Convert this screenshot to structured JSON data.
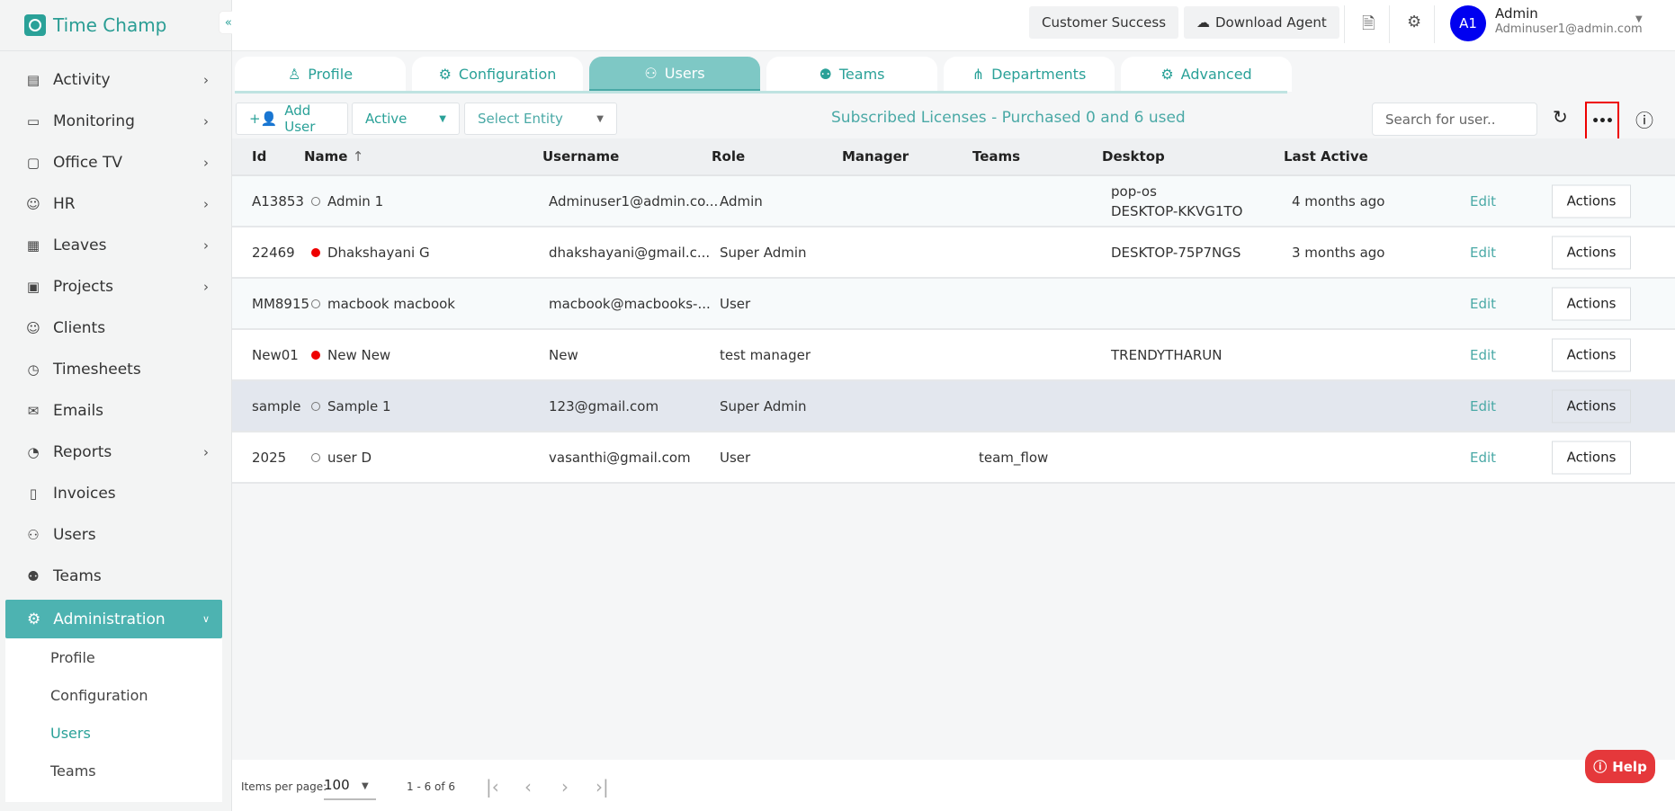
{
  "app": {
    "name": "Time Champ"
  },
  "sidebar": {
    "items": [
      {
        "label": "Activity",
        "icon": "activity-icon",
        "chev": true
      },
      {
        "label": "Monitoring",
        "icon": "monitor-icon",
        "chev": true
      },
      {
        "label": "Office TV",
        "icon": "tv-icon",
        "chev": true
      },
      {
        "label": "HR",
        "icon": "person-icon",
        "chev": true
      },
      {
        "label": "Leaves",
        "icon": "calendar-icon",
        "chev": true
      },
      {
        "label": "Projects",
        "icon": "briefcase-icon",
        "chev": true
      },
      {
        "label": "Clients",
        "icon": "client-icon",
        "chev": false
      },
      {
        "label": "Timesheets",
        "icon": "alarm-icon",
        "chev": false
      },
      {
        "label": "Emails",
        "icon": "mail-icon",
        "chev": false
      },
      {
        "label": "Reports",
        "icon": "pie-icon",
        "chev": true
      },
      {
        "label": "Invoices",
        "icon": "invoice-icon",
        "chev": false
      },
      {
        "label": "Users",
        "icon": "users-icon",
        "chev": false
      },
      {
        "label": "Teams",
        "icon": "teams-icon",
        "chev": false
      }
    ],
    "admin": {
      "label": "Administration",
      "sub": [
        "Profile",
        "Configuration",
        "Users",
        "Teams"
      ]
    }
  },
  "header": {
    "customer_success": "Customer Success",
    "download_agent": "Download Agent",
    "user": {
      "initials": "A1",
      "name": "Admin",
      "email": "Adminuser1@admin.com"
    }
  },
  "tabs": [
    "Profile",
    "Configuration",
    "Users",
    "Teams",
    "Departments",
    "Advanced"
  ],
  "toolbar": {
    "add_user": "Add User",
    "status": "Active",
    "entity_placeholder": "Select Entity",
    "license": "Subscribed Licenses - Purchased 0 and 6 used",
    "search_placeholder": "Search for user.."
  },
  "table": {
    "headers": [
      "Id",
      "Name",
      "Username",
      "Role",
      "Manager",
      "Teams",
      "Desktop",
      "Last Active"
    ],
    "sort_icon": "↑",
    "rows": [
      {
        "id": "A13853",
        "name": "Admin 1",
        "online": false,
        "username": "Adminuser1@admin.co...",
        "role": "Admin",
        "manager": "",
        "teams": "",
        "desktop": [
          "pop-os",
          "DESKTOP-KKVG1TO"
        ],
        "last": "4 months ago",
        "edit": "Edit",
        "actions": "Actions"
      },
      {
        "id": "22469",
        "name": "Dhakshayani G",
        "online": true,
        "username": "dhakshayani@gmail.c...",
        "role": "Super Admin",
        "manager": "",
        "teams": "",
        "desktop": [
          "DESKTOP-75P7NGS"
        ],
        "last": "3 months ago",
        "edit": "Edit",
        "actions": "Actions"
      },
      {
        "id": "MM8915",
        "name": "macbook macbook",
        "online": false,
        "username": "macbook@macbooks-...",
        "role": "User",
        "manager": "",
        "teams": "",
        "desktop": [],
        "last": "",
        "edit": "Edit",
        "actions": "Actions"
      },
      {
        "id": "New01",
        "name": "New New",
        "online": true,
        "username": "New",
        "role": "test manager",
        "manager": "",
        "teams": "",
        "desktop": [
          "TRENDYTHARUN"
        ],
        "last": "",
        "edit": "Edit",
        "actions": "Actions"
      },
      {
        "id": "sample",
        "name": "Sample 1",
        "online": false,
        "username": "123@gmail.com",
        "role": "Super Admin",
        "manager": "",
        "teams": "",
        "desktop": [],
        "last": "",
        "edit": "Edit",
        "actions": "Actions"
      },
      {
        "id": "2025",
        "name": "user D",
        "online": false,
        "username": "vasanthi@gmail.com",
        "role": "User",
        "manager": "",
        "teams": "team_flow",
        "desktop": [],
        "last": "",
        "edit": "Edit",
        "actions": "Actions"
      }
    ]
  },
  "footer": {
    "items_label": "Items per page:",
    "per_page": "100",
    "range": "1 - 6 of 6"
  },
  "help": {
    "label": "Help"
  },
  "colors": {
    "accent": "#4db3b1",
    "help": "#e5383b",
    "avatar": "#0000f0"
  }
}
